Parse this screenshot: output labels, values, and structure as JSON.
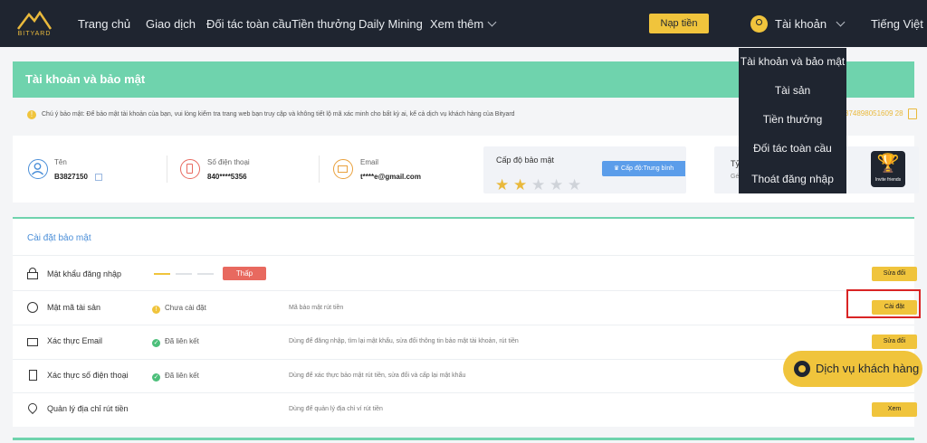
{
  "brand": {
    "logo_text": "BITYARD"
  },
  "nav": {
    "items": [
      "Trang chủ",
      "Giao dịch",
      "Đối tác toàn cầu",
      "Tiền thưởng",
      "Daily Mining"
    ],
    "more": "Xem thêm",
    "deposit": "Nạp tiền",
    "account": "Tài khoản",
    "language": "Tiếng Việt"
  },
  "page": {
    "title": "Tài khoản và bảo mật"
  },
  "notice": {
    "text": "Chú ý bảo mật: Để bảo mật tài khoản của bạn, vui lòng kiểm tra trang web bạn truy cập và không tiết lộ mã xác minh cho bất kỳ ai, kể cả dịch vụ khách hàng của Bityard",
    "uid": "374898051609 28"
  },
  "profile": {
    "name_label": "Tên",
    "name_value": "B3827150",
    "phone_label": "Số điện thoại",
    "phone_value": "840****5356",
    "email_label": "Email",
    "email_value": "t****e@gmail.com",
    "security_label": "Cấp độ bảo mật",
    "security_stars": 2,
    "security_stars_max": 5,
    "level_badge": "Cấp độ:Trung bình",
    "ratio_label": "Tỷ",
    "ratio_sub": "Gé",
    "badge_text": "Invite friends"
  },
  "settings": {
    "title": "Cài đặt bảo mật",
    "rows": [
      {
        "name": "Mật khẩu đăng nhập",
        "status": "",
        "strength": "Thấp",
        "strength_level": 1,
        "strength_max": 3,
        "desc": "",
        "button": "Sửa đổi"
      },
      {
        "name": "Mật mã tài sản",
        "status": "Chưa cài đặt",
        "desc": "Mã bảo mật rút tiền",
        "button": "Cài đặt"
      },
      {
        "name": "Xác thực Email",
        "status": "Đã liên kết",
        "desc": "Dùng để đăng nhập, tìm lại mật khẩu, sửa đổi thông tin bảo mật tài khoản, rút tiền",
        "button": "Sửa đổi"
      },
      {
        "name": "Xác thực số điện thoại",
        "status": "Đã liên kết",
        "desc": "Dùng để xác thực bảo mật rút tiền, sửa đổi và cấp lại mật khẩu",
        "button": ""
      },
      {
        "name": "Quản lý địa chỉ rút tiền",
        "status": "",
        "desc": "Dùng để quản lý địa chỉ ví rút tiền",
        "button": "Xem"
      }
    ]
  },
  "dropdown": {
    "items": [
      "Tài khoản và bảo mật",
      "Tài sản",
      "Tiền thưởng",
      "Đối tác toàn cầu",
      "Thoát đăng nhập"
    ]
  },
  "support": {
    "label": "Dịch vụ khách hàng"
  },
  "colors": {
    "brand": "#f0c43c",
    "accent": "#6fd3ad",
    "topbar": "#1f2530",
    "danger": "#e8695f",
    "link": "#4a8ed8"
  }
}
